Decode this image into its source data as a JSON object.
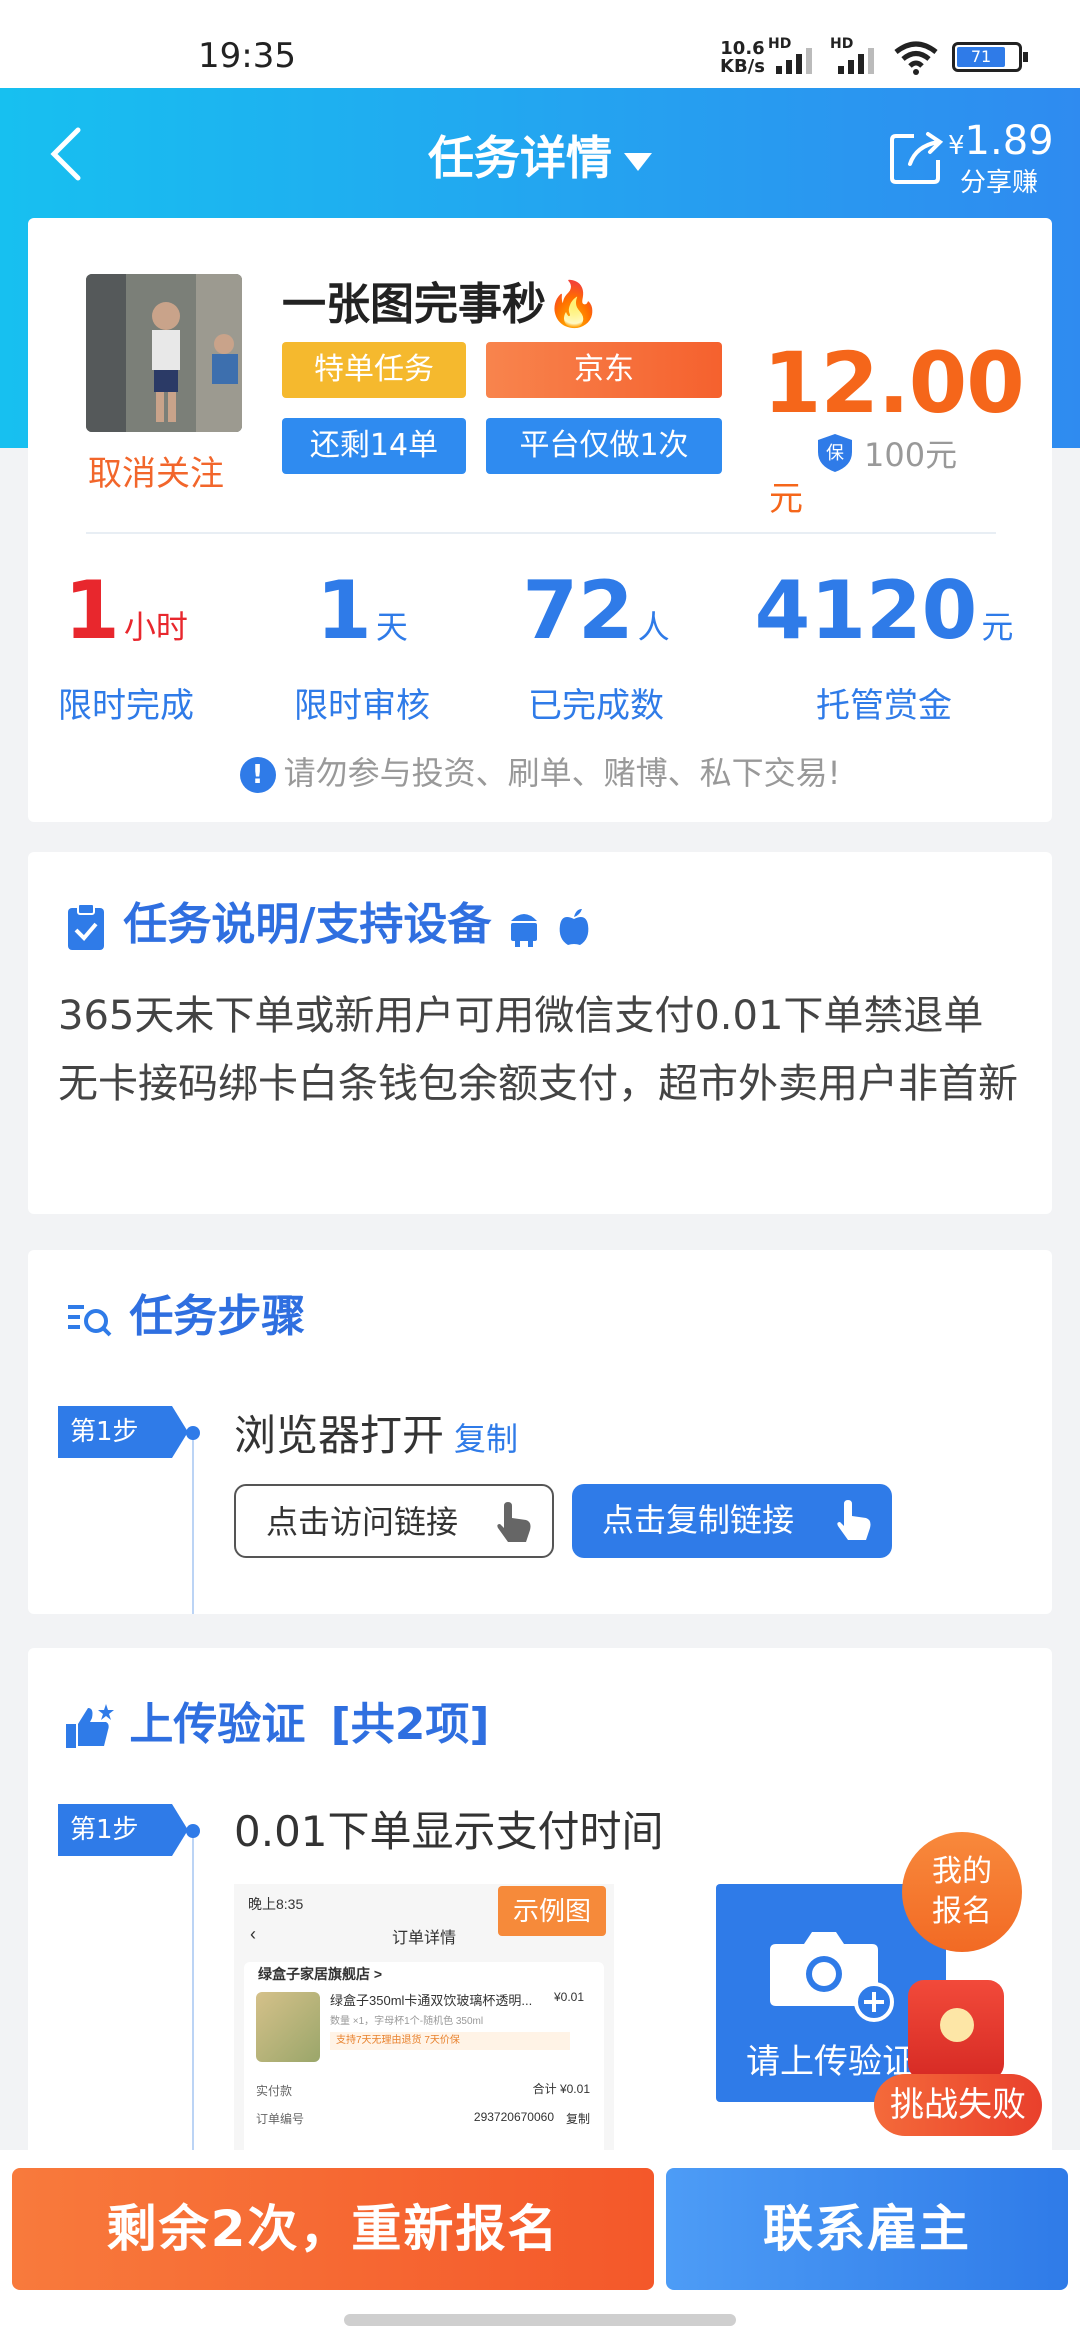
{
  "status_bar": {
    "time": "19:35",
    "net_speed": "10.6",
    "net_unit": "KB/s",
    "hd1": "HD",
    "hd2": "HD",
    "battery": "71"
  },
  "nav": {
    "title": "任务详情",
    "share_amount": "1.89",
    "currency": "¥",
    "share_label": "分享赚"
  },
  "task": {
    "title": "一张图完事秒",
    "unfollow": "取消关注",
    "tags": [
      "特单任务",
      "京东",
      "还剩14单",
      "平台仅做1次"
    ],
    "price": "12.00",
    "price_unit": "元",
    "deposit_badge": "保",
    "deposit": "100元",
    "stats": [
      {
        "value": "1",
        "unit": "小时",
        "label": "限时完成"
      },
      {
        "value": "1",
        "unit": "天",
        "label": "限时审核"
      },
      {
        "value": "72",
        "unit": "人",
        "label": "已完成数"
      },
      {
        "value": "4120",
        "unit": "元",
        "label": "托管赏金"
      }
    ],
    "warning": "请勿参与投资、刷单、赌博、私下交易!"
  },
  "description": {
    "heading": "任务说明/支持设备",
    "text": "365天未下单或新用户可用微信支付0.01下单禁退单无卡接码绑卡白条钱包余额支付，超市外卖用户非首新"
  },
  "steps": {
    "heading": "任务步骤",
    "items": [
      {
        "badge": "第1步",
        "text": "浏览器打开",
        "copy": "复制",
        "btn_visit": "点击访问链接",
        "btn_copy": "点击复制链接"
      }
    ]
  },
  "upload": {
    "heading": "上传验证",
    "count": "[共2项]",
    "items": [
      {
        "badge": "第1步",
        "text": "0.01下单显示支付时间",
        "example_label": "示例图",
        "upload_label": "请上传验证"
      }
    ],
    "example": {
      "time": "晚上8:35",
      "title": "订单详情",
      "store": "绿盒子家居旗舰店 >",
      "product": "绿盒子350ml卡通双饮玻璃杯透明...",
      "price": "¥0.01",
      "spec": "数量 ×1，字母杯1个-随机色 350ml",
      "service": "支持7天无理由退货  7天价保",
      "paid_label": "实付款",
      "total": "合计 ¥0.01",
      "order_label": "订单编号",
      "order_no": "293720670060",
      "copy": "复制"
    }
  },
  "floating": {
    "my_signup": "我的报名",
    "challenge_fail": "挑战失败"
  },
  "bottom": {
    "reapply": "剩余2次，重新报名",
    "contact": "联系雇主"
  },
  "colors": {
    "brand_blue": "#2f7be8",
    "orange": "#f5661a",
    "header_gradient_start": "#17c0f0",
    "header_gradient_end": "#2f8bf0"
  }
}
